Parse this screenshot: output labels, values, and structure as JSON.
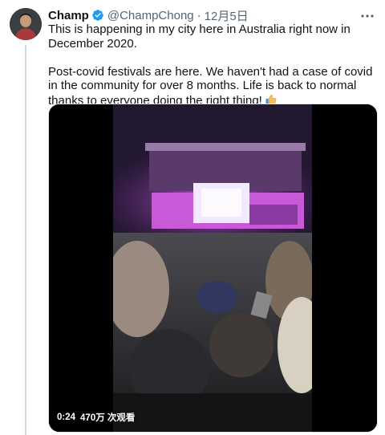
{
  "tweet": {
    "author_name": "Champ",
    "handle": "@ChampChong",
    "separator": "·",
    "date": "12月5日",
    "paragraphs": [
      "This is happening in my city here in Australia right now in December 2020.",
      "Post-covid festivals are here. We haven't had a case of covid in the community for over 8 months. Life is back to normal thanks to everyone doing the right thing!"
    ],
    "emoji": "thumbs-up-emoji",
    "verified_icon": "verified-badge-icon",
    "more_icon": "more-options-icon"
  },
  "video": {
    "duration": "0:24",
    "views": "470万 次观看"
  },
  "colors": {
    "verified": "#1d9bf0",
    "secondary_text": "#536471",
    "stage_light": "#c040d0"
  }
}
